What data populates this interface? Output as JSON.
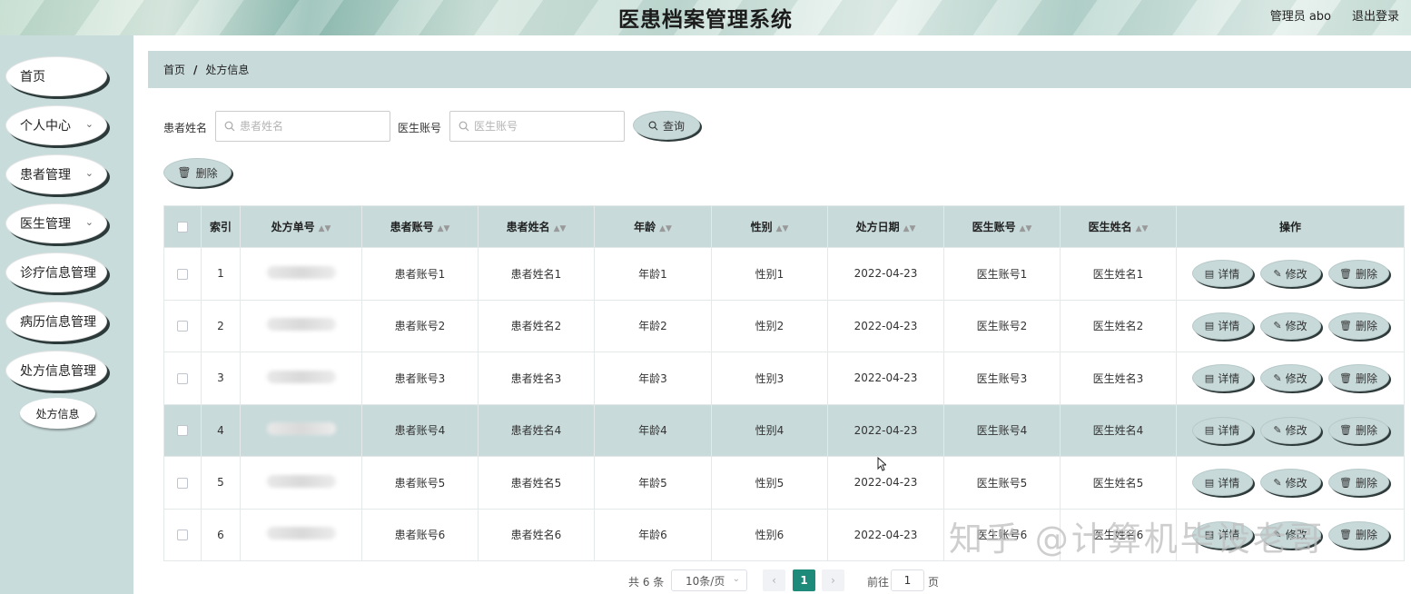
{
  "header": {
    "title": "医患档案管理系统",
    "user": "管理员 abo",
    "logout": "退出登录"
  },
  "sidebar": {
    "items": [
      {
        "label": "首页",
        "has_arrow": false
      },
      {
        "label": "个人中心",
        "has_arrow": true
      },
      {
        "label": "患者管理",
        "has_arrow": true
      },
      {
        "label": "医生管理",
        "has_arrow": true
      },
      {
        "label": "诊疗信息管理",
        "has_arrow": false
      },
      {
        "label": "病历信息管理",
        "has_arrow": false
      },
      {
        "label": "处方信息管理",
        "has_arrow": false
      }
    ],
    "sub_items": [
      {
        "label": "处方信息"
      }
    ],
    "chevron": "chevron-down-icon"
  },
  "breadcrumb": {
    "home": "首页",
    "separator": "/",
    "current": "处方信息"
  },
  "search": {
    "patient_label": "患者姓名",
    "patient_placeholder": "患者姓名",
    "patient_value": "",
    "doctor_label": "医生账号",
    "doctor_placeholder": "医生账号",
    "doctor_value": "",
    "query_label": "查询"
  },
  "toolbar": {
    "delete_label": "删除"
  },
  "table": {
    "columns": [
      "索引",
      "处方单号",
      "患者账号",
      "患者姓名",
      "年龄",
      "性别",
      "处方日期",
      "医生账号",
      "医生姓名",
      "操作"
    ],
    "rows": [
      {
        "index": "1",
        "patient_account": "患者账号1",
        "patient_name": "患者姓名1",
        "age": "年龄1",
        "gender": "性别1",
        "date": "2022-04-23",
        "doctor_account": "医生账号1",
        "doctor_name": "医生姓名1",
        "highlighted": false
      },
      {
        "index": "2",
        "patient_account": "患者账号2",
        "patient_name": "患者姓名2",
        "age": "年龄2",
        "gender": "性别2",
        "date": "2022-04-23",
        "doctor_account": "医生账号2",
        "doctor_name": "医生姓名2",
        "highlighted": false
      },
      {
        "index": "3",
        "patient_account": "患者账号3",
        "patient_name": "患者姓名3",
        "age": "年龄3",
        "gender": "性别3",
        "date": "2022-04-23",
        "doctor_account": "医生账号3",
        "doctor_name": "医生姓名3",
        "highlighted": false
      },
      {
        "index": "4",
        "patient_account": "患者账号4",
        "patient_name": "患者姓名4",
        "age": "年龄4",
        "gender": "性别4",
        "date": "2022-04-23",
        "doctor_account": "医生账号4",
        "doctor_name": "医生姓名4",
        "highlighted": true
      },
      {
        "index": "5",
        "patient_account": "患者账号5",
        "patient_name": "患者姓名5",
        "age": "年龄5",
        "gender": "性别5",
        "date": "2022-04-23",
        "doctor_account": "医生账号5",
        "doctor_name": "医生姓名5",
        "highlighted": false
      },
      {
        "index": "6",
        "patient_account": "患者账号6",
        "patient_name": "患者姓名6",
        "age": "年龄6",
        "gender": "性别6",
        "date": "2022-04-23",
        "doctor_account": "医生账号6",
        "doctor_name": "医生姓名6",
        "highlighted": false
      }
    ],
    "actions": {
      "detail": "详情",
      "edit": "修改",
      "delete": "删除"
    }
  },
  "pagination": {
    "total": "共 6 条",
    "page_size": "10条/页",
    "current_page": "1",
    "goto_label": "前往",
    "goto_value": "1",
    "page_suffix": "页"
  },
  "watermark": "知乎 @计算机毕设老哥",
  "colors": {
    "accent": "#1d8a7a",
    "panel": "#c8dada",
    "sidebar": "#c9dcdc"
  }
}
